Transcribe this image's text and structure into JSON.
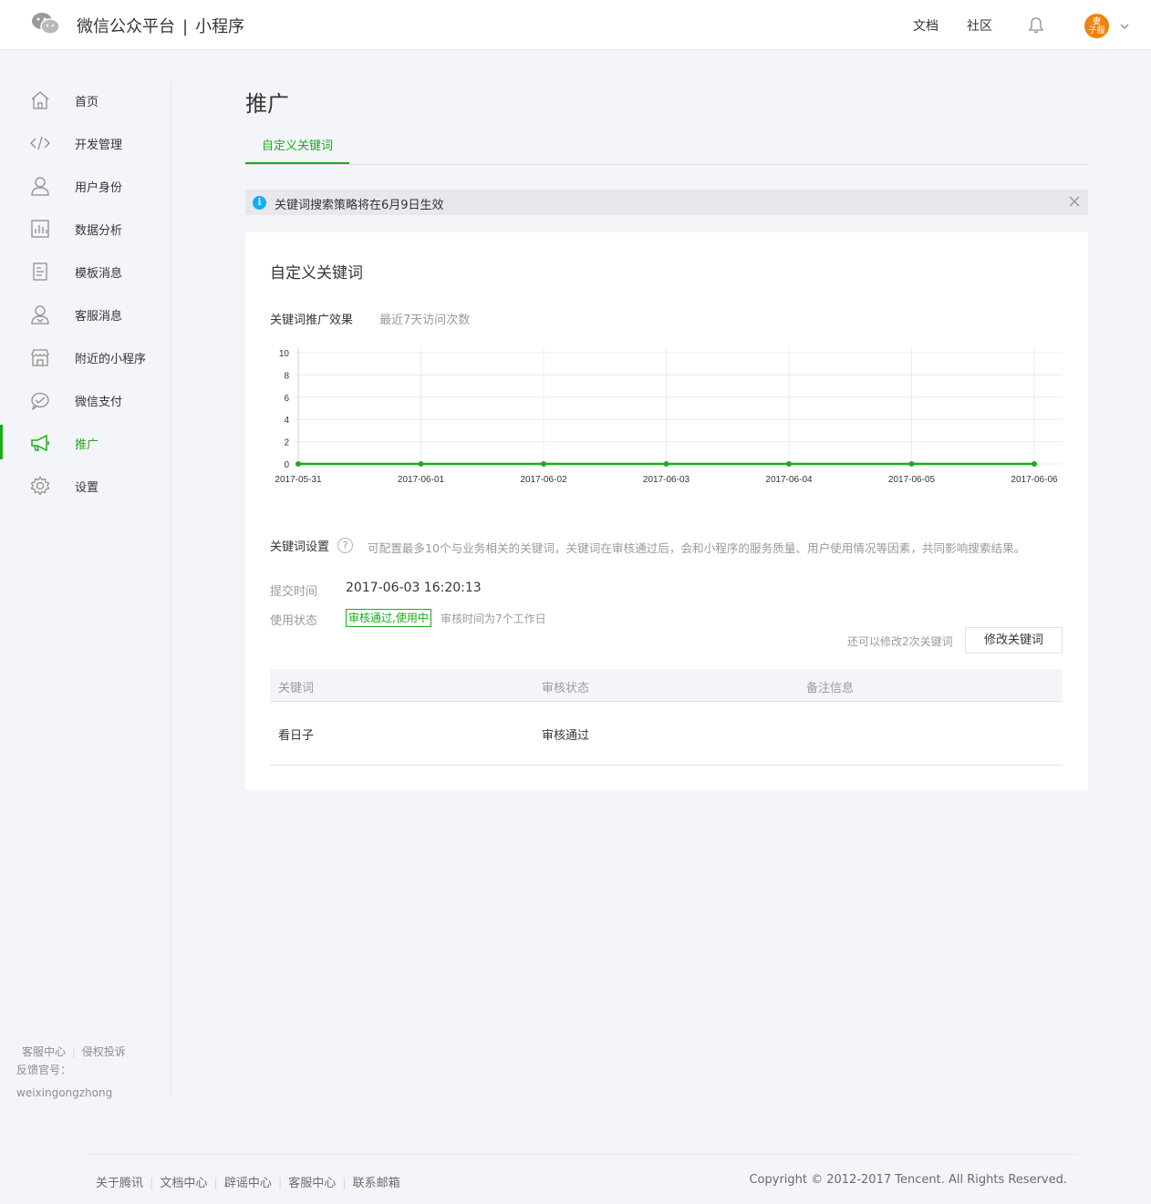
{
  "header": {
    "platform_name": "微信公众平台",
    "separator": "|",
    "product_name": "小程序",
    "links": [
      "文档",
      "社区"
    ],
    "avatar_text": [
      "妻",
      "子服"
    ]
  },
  "sidebar": {
    "items": [
      {
        "label": "首页",
        "icon": "home-icon"
      },
      {
        "label": "开发管理",
        "icon": "code-icon"
      },
      {
        "label": "用户身份",
        "icon": "user-icon"
      },
      {
        "label": "数据分析",
        "icon": "bar-chart-icon"
      },
      {
        "label": "模板消息",
        "icon": "document-icon"
      },
      {
        "label": "客服消息",
        "icon": "customer-service-icon"
      },
      {
        "label": "附近的小程序",
        "icon": "store-icon"
      },
      {
        "label": "微信支付",
        "icon": "payment-icon"
      },
      {
        "label": "推广",
        "icon": "megaphone-icon",
        "active": true
      },
      {
        "label": "设置",
        "icon": "gear-icon"
      }
    ],
    "footer": {
      "service_center": "客服中心",
      "complaint": "侵权投诉",
      "feedback_label": "反馈官号：",
      "feedback_account": "weixingongzhong"
    }
  },
  "main": {
    "title": "推广",
    "tab": "自定义关键词",
    "notice": "关键词搜索策略将在6月9日生效",
    "card": {
      "title": "自定义关键词",
      "chart_label": "关键词推广效果",
      "chart_sub": "最近7天访问次数",
      "keyword_setting_label": "关键词设置",
      "keyword_setting_desc": "可配置最多10个与业务相关的关键词，关键词在审核通过后，会和小程序的服务质量、用户使用情况等因素，共同影响搜索结果。",
      "submit_time_label": "提交时间",
      "submit_time_value": "2017-06-03 16:20:13",
      "status_label": "使用状态",
      "status_value": "审核通过,使用中",
      "review_time": "审核时间为7个工作日",
      "remaining": "还可以修改2次关键词",
      "edit_button": "修改关键词",
      "table": {
        "headers": [
          "关键词",
          "审核状态",
          "备注信息"
        ],
        "rows": [
          [
            "看日子",
            "审核通过",
            ""
          ]
        ]
      }
    }
  },
  "chart_data": {
    "type": "line",
    "x": [
      "2017-05-31",
      "2017-06-01",
      "2017-06-02",
      "2017-06-03",
      "2017-06-04",
      "2017-06-05",
      "2017-06-06"
    ],
    "series": [
      {
        "values": [
          0,
          0,
          0,
          0,
          0,
          0,
          0
        ],
        "color": "#1aad19"
      }
    ],
    "yticks": [
      0,
      2,
      4,
      6,
      8,
      10
    ],
    "ylim": [
      0,
      10
    ],
    "grid": true
  },
  "footer": {
    "links": [
      "关于腾讯",
      "文档中心",
      "辟谣中心",
      "客服中心",
      "联系邮箱"
    ],
    "copyright": "Copyright © 2012-2017 Tencent. All Rights Reserved."
  }
}
